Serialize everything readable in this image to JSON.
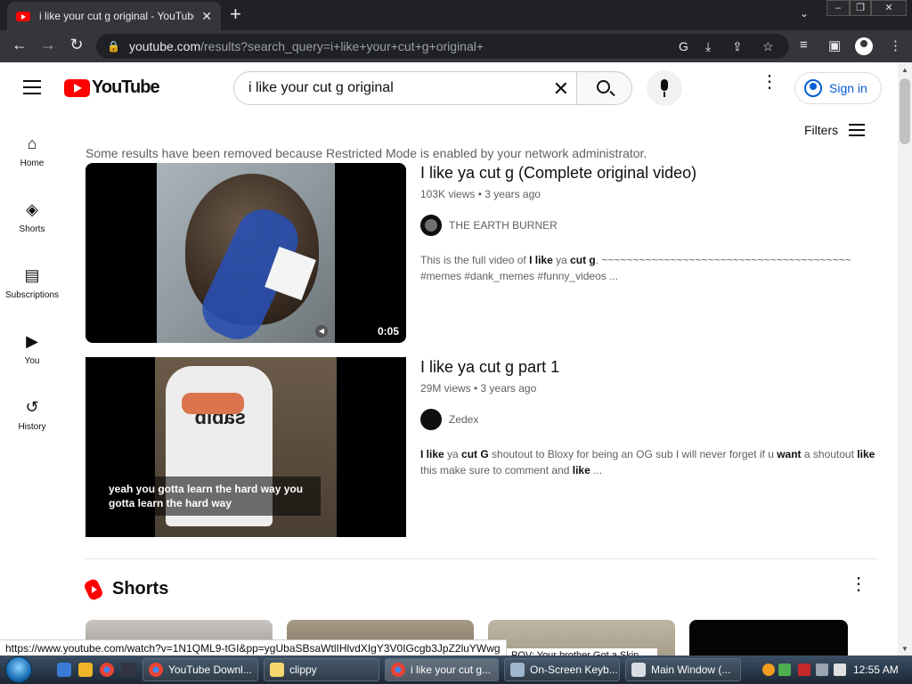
{
  "browser": {
    "tab_title": "i like your cut g original - YouTube",
    "tab_close": "✕",
    "new_tab": "+",
    "url_host": "youtube.com",
    "url_path": "/results?search_query=i+like+your+cut+g+original+",
    "status_url": "https://www.youtube.com/watch?v=1N1QML9-tGI&pp=ygUbaSBsaWtlIHlvdXIgY3V0IGcgb3JpZ2luYWwg"
  },
  "header": {
    "logo_text": "YouTube",
    "search_value": "i like your cut g original",
    "sign_in": "Sign in"
  },
  "sidebar": {
    "items": [
      {
        "label": "Home",
        "icon": "home-icon"
      },
      {
        "label": "Shorts",
        "icon": "shorts-icon"
      },
      {
        "label": "Subscriptions",
        "icon": "subscriptions-icon"
      },
      {
        "label": "You",
        "icon": "you-icon"
      },
      {
        "label": "History",
        "icon": "history-icon"
      }
    ]
  },
  "filters": {
    "label": "Filters"
  },
  "notice": "Some results have been removed because Restricted Mode is enabled by your network administrator.",
  "results": [
    {
      "title": "I like ya cut g (Complete original video)",
      "meta": "103K views • 3 years ago",
      "channel": "THE EARTH BURNER",
      "desc_pre": "This is the full video of ",
      "desc_b1": "I like",
      "desc_mid": " ya ",
      "desc_b2": "cut g",
      "desc_post": ". ~~~~~~~~~~~~~~~~~~~~~~~~~~~~~~~~~~~~~~~~ #memes #dank_memes #funny_videos ...",
      "duration": "0:05"
    },
    {
      "title": "I like ya cut g part 1",
      "meta": "29M views • 3 years ago",
      "channel": "Zedex",
      "desc_b1": "I like",
      "desc_mid1": " ya ",
      "desc_b2": "cut G",
      "desc_mid2": " shoutout to Bloxy for being an OG sub I will never forget if u ",
      "desc_b3": "want",
      "desc_mid3": " a shoutout ",
      "desc_b4": "like",
      "desc_mid4": " this make sure to comment and ",
      "desc_b5": "like",
      "desc_post": " ...",
      "caption": "yeah you gotta learn the hard way you gotta learn the hard way"
    }
  ],
  "shorts": {
    "title": "Shorts",
    "third_caption": "POV: Your brother Got a Skin"
  },
  "taskbar": {
    "tasks": [
      "YouTube Downl...",
      "clippy",
      "i like your cut g...",
      "On-Screen Keyb...",
      "Main Window (..."
    ],
    "clock": "12:55 AM"
  }
}
